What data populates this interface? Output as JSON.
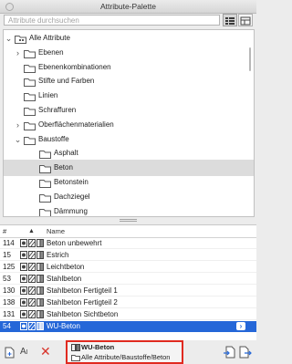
{
  "window": {
    "title": "Attribute-Palette"
  },
  "search": {
    "placeholder": "Attribute durchsuchen",
    "value": ""
  },
  "tree": {
    "items": [
      {
        "label": "Alle Attribute",
        "state": "expanded",
        "level": 0
      },
      {
        "label": "Ebenen",
        "state": "collapsed",
        "level": 1
      },
      {
        "label": "Ebenenkombinationen",
        "state": "leaf",
        "level": 1
      },
      {
        "label": "Stifte und Farben",
        "state": "leaf",
        "level": 1
      },
      {
        "label": "Linien",
        "state": "leaf",
        "level": 1
      },
      {
        "label": "Schraffuren",
        "state": "leaf",
        "level": 1
      },
      {
        "label": "Oberflächenmaterialien",
        "state": "collapsed",
        "level": 1
      },
      {
        "label": "Baustoffe",
        "state": "expanded",
        "level": 1
      },
      {
        "label": "Asphalt",
        "state": "leaf",
        "level": 2
      },
      {
        "label": "Beton",
        "state": "leaf",
        "level": 2,
        "selected": true
      },
      {
        "label": "Betonstein",
        "state": "leaf",
        "level": 2
      },
      {
        "label": "Dachziegel",
        "state": "leaf",
        "level": 2
      },
      {
        "label": "Dämmung",
        "state": "leaf",
        "level": 2
      }
    ]
  },
  "list": {
    "headers": {
      "number": "#",
      "sort": "▲",
      "name": "Name"
    },
    "rows": [
      {
        "number": "114",
        "name": "Beton unbewehrt"
      },
      {
        "number": "15",
        "name": "Estrich"
      },
      {
        "number": "125",
        "name": "Leichtbeton"
      },
      {
        "number": "53",
        "name": "Stahlbeton"
      },
      {
        "number": "130",
        "name": "Stahlbeton Fertigteil 1"
      },
      {
        "number": "138",
        "name": "Stahlbeton Fertigteil 2"
      },
      {
        "number": "131",
        "name": "Stahlbeton Sichtbeton"
      },
      {
        "number": "54",
        "name": "WU-Beton",
        "selected": true
      }
    ]
  },
  "popup": {
    "title": "WU-Beton",
    "path": "Alle Attribute/Baustoffe/Beton"
  },
  "colors": {
    "selection_blue": "#2567d8",
    "delete_red": "#d8342b",
    "highlight_red": "#e02a20",
    "folder_stroke": "#5a5a5a"
  }
}
